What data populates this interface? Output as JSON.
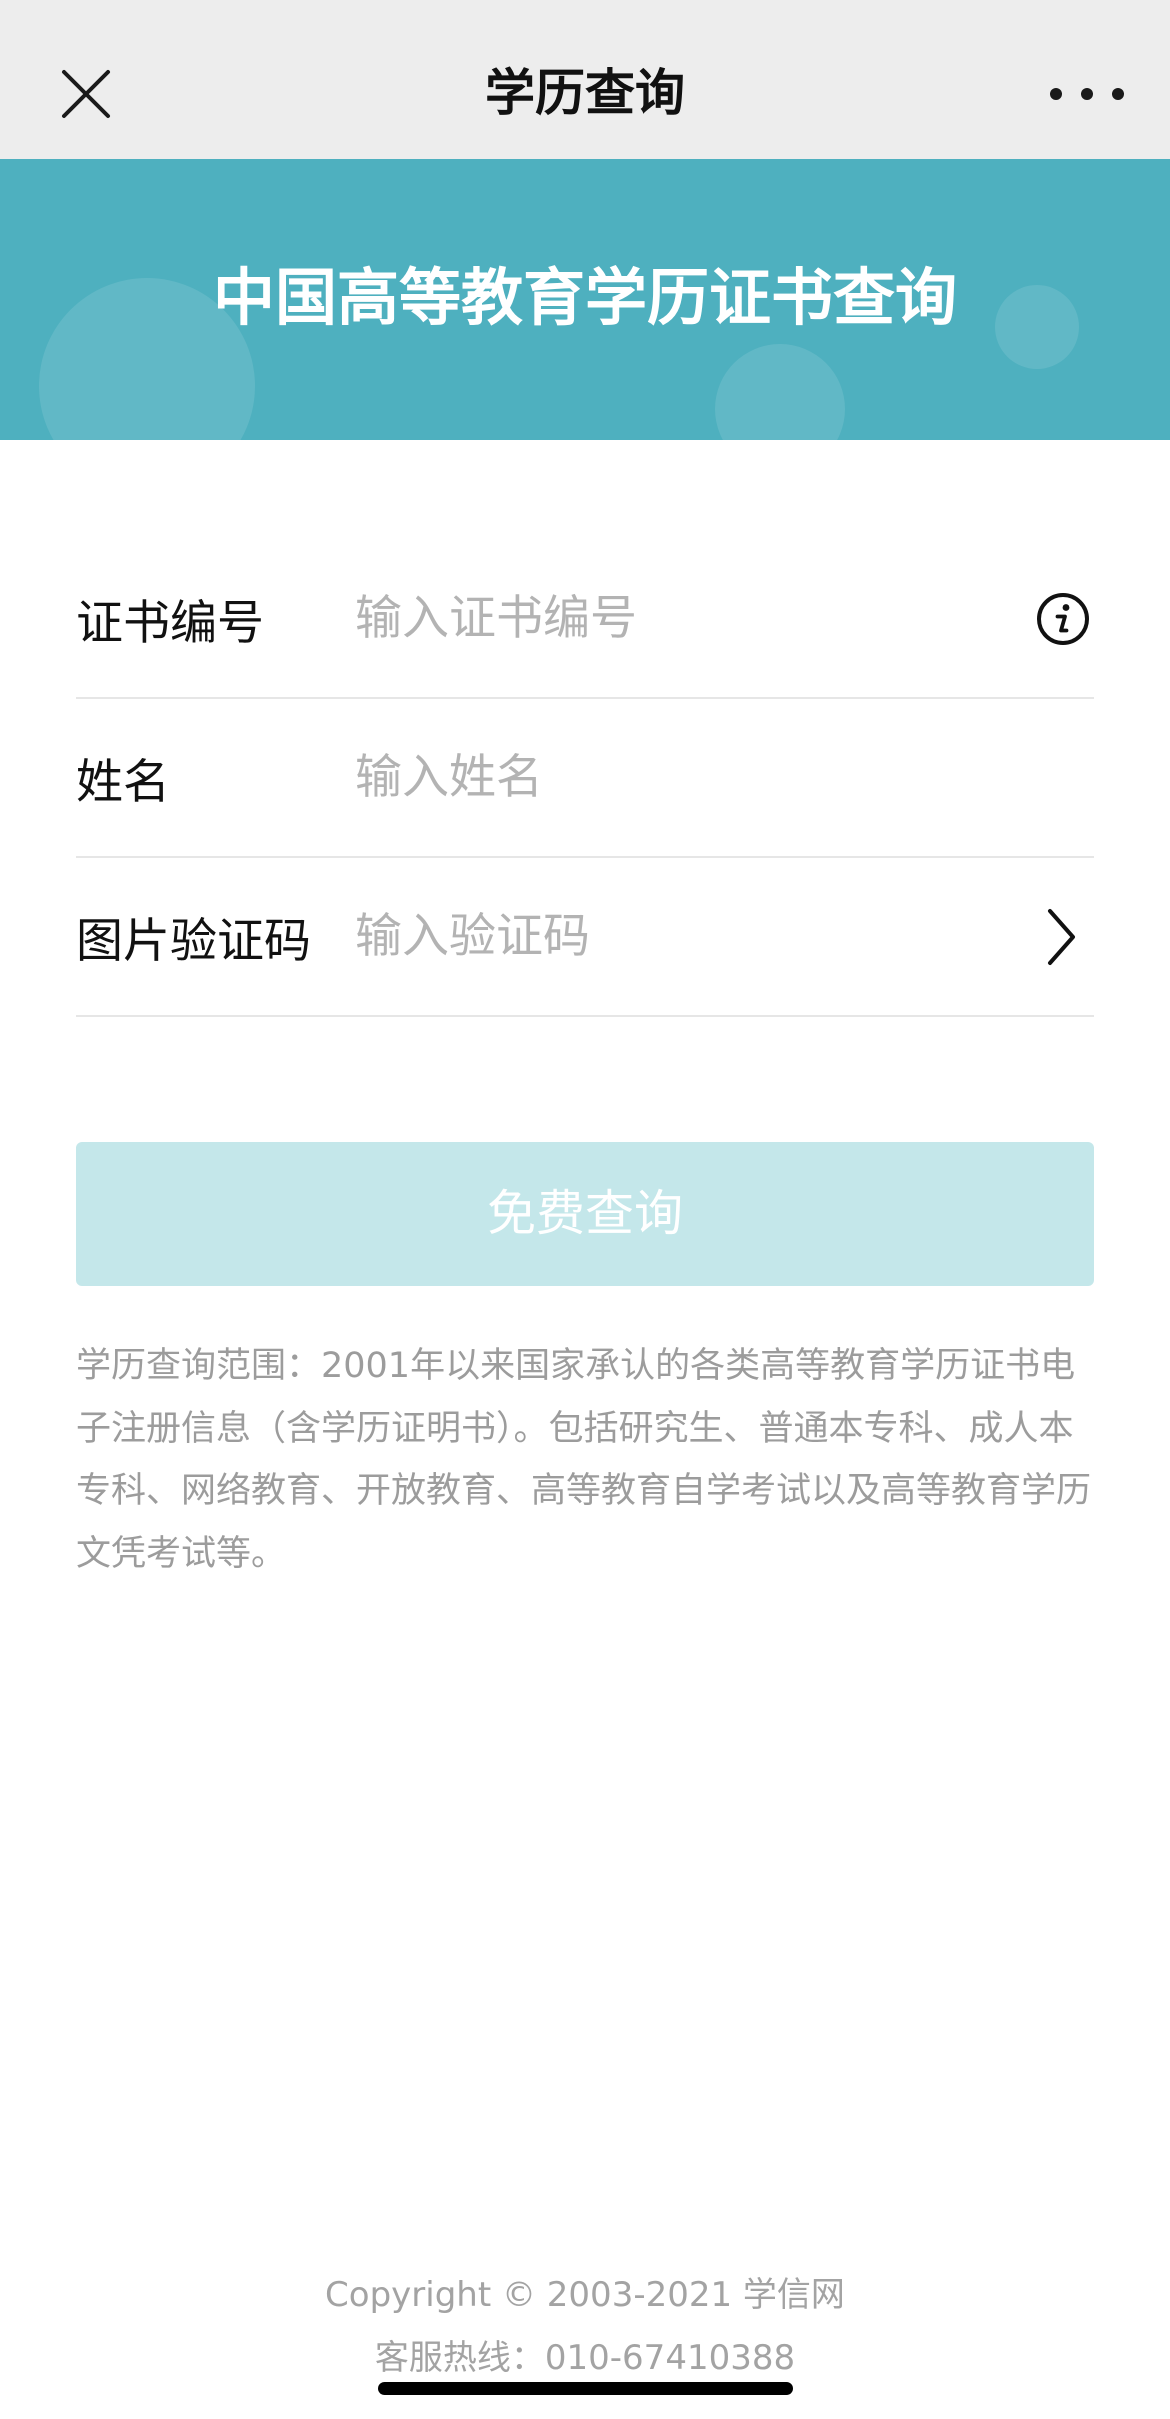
{
  "nav": {
    "title": "学历查询",
    "close_icon": "close-icon",
    "more_icon": "more-icon"
  },
  "banner": {
    "title": "中国高等教育学历证书查询"
  },
  "form": {
    "fields": [
      {
        "label": "证书编号",
        "placeholder": "输入证书编号",
        "value": "",
        "trailing_icon": "info-icon"
      },
      {
        "label": "姓名",
        "placeholder": "输入姓名",
        "value": ""
      },
      {
        "label": "图片验证码",
        "placeholder": "输入验证码",
        "value": "",
        "trailing_icon": "chevron-right-icon"
      }
    ],
    "submit_label": "免费查询"
  },
  "description": {
    "text": "学历查询范围：2001年以来国家承认的各类高等教育学历证书电子注册信息（含学历证明书）。包括研究生、普通本专科、成人本专科、网络教育、开放教育、高等教育自学考试以及高等教育学历文凭考试等。"
  },
  "footer": {
    "copyright": "Copyright © 2003-2021 学信网",
    "hotline": "客服热线：010-67410388"
  },
  "colors": {
    "nav_bg": "#ededed",
    "banner_bg": "#4eb0bf",
    "button_bg": "#c4e7ea",
    "text_placeholder": "#b3b3b3",
    "text_muted": "#9c9c9c"
  }
}
